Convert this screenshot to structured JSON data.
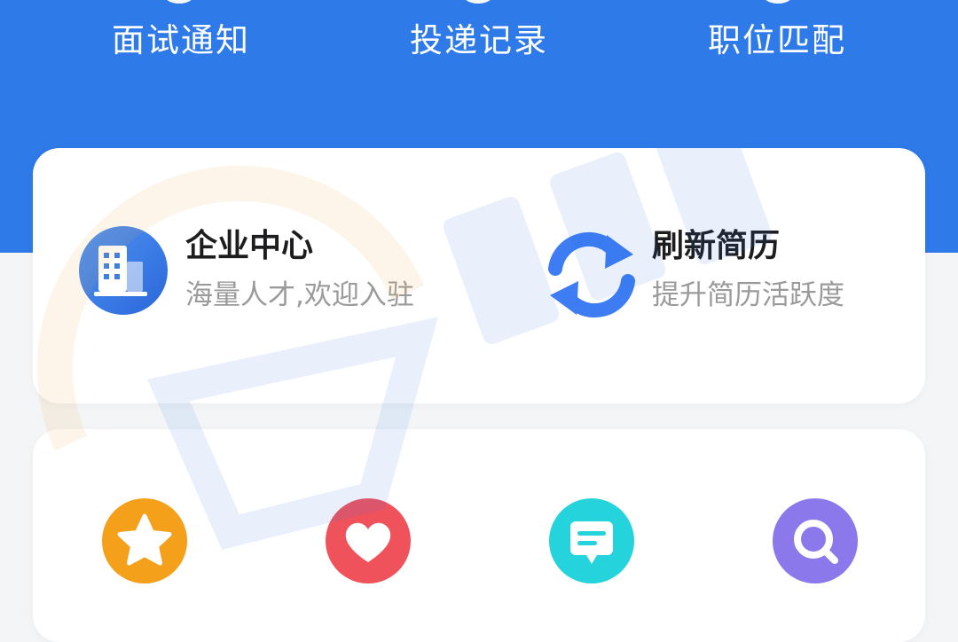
{
  "nav_tabs": [
    {
      "label": "面试通知"
    },
    {
      "label": "投递记录"
    },
    {
      "label": "职位匹配"
    }
  ],
  "features": [
    {
      "title": "企业中心",
      "subtitle": "海量人才,欢迎入驻",
      "icon": "building-icon"
    },
    {
      "title": "刷新简历",
      "subtitle": "提升简历活跃度",
      "icon": "refresh-icon"
    }
  ],
  "grid_icons": [
    {
      "icon": "star-icon",
      "color": "#f4a01a"
    },
    {
      "icon": "heart-icon",
      "color": "#f0525c"
    },
    {
      "icon": "message-icon",
      "color": "#25d3dc"
    },
    {
      "icon": "search-icon",
      "color": "#8b79ec"
    }
  ],
  "colors": {
    "header": "#2f7ae9",
    "background": "#f4f5f7",
    "card": "#ffffff"
  }
}
